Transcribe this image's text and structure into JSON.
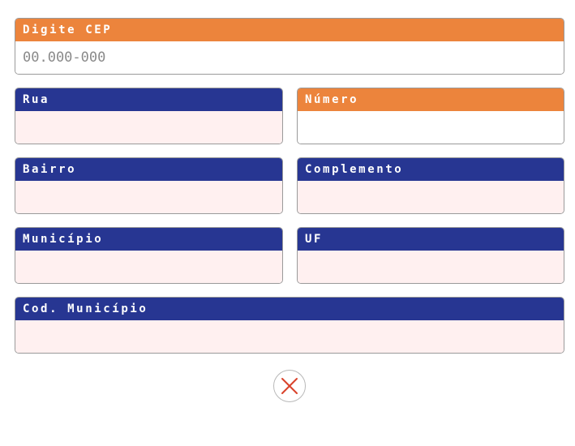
{
  "colors": {
    "primary_header": "#273692",
    "accent_header": "#ec843c",
    "input_background": "#fff0f0",
    "close_icon": "#d9432b"
  },
  "cep": {
    "label": "Digite CEP",
    "placeholder": "00.000-000",
    "value": ""
  },
  "rua": {
    "label": "Rua",
    "value": ""
  },
  "numero": {
    "label": "Número",
    "value": ""
  },
  "bairro": {
    "label": "Bairro",
    "value": ""
  },
  "complemento": {
    "label": "Complemento",
    "value": ""
  },
  "municipio": {
    "label": "Município",
    "value": ""
  },
  "uf": {
    "label": "UF",
    "value": ""
  },
  "cod_municipio": {
    "label": "Cod. Município",
    "value": ""
  },
  "close": {
    "icon": "close-icon"
  }
}
